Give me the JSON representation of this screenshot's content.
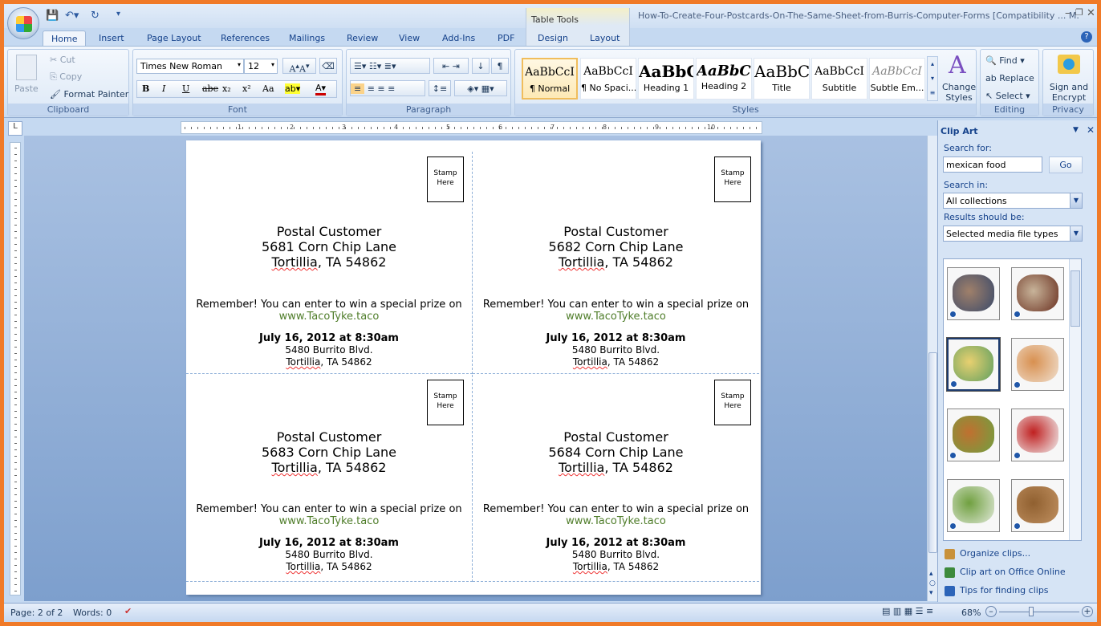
{
  "app": {
    "title": "How-To-Create-Four-Postcards-On-The-Same-Sheet-from-Burris-Computer-Forms [Compatibility ... M.",
    "contextual_group": "Table Tools"
  },
  "quick_access": [
    "save-icon",
    "undo-icon",
    "redo-icon",
    "customize-icon"
  ],
  "tabs": [
    "Home",
    "Insert",
    "Page Layout",
    "References",
    "Mailings",
    "Review",
    "View",
    "Add-Ins",
    "PDF",
    "Design",
    "Layout"
  ],
  "active_tab": "Home",
  "ribbon": {
    "clipboard": {
      "label": "Clipboard",
      "paste": "Paste",
      "cut": "Cut",
      "copy": "Copy",
      "format_painter": "Format Painter"
    },
    "font": {
      "label": "Font",
      "font_name": "Times New Roman",
      "font_size": "12",
      "buttons": [
        "B",
        "I",
        "U",
        "abe",
        "x₂",
        "x²",
        "Aa"
      ]
    },
    "paragraph": {
      "label": "Paragraph"
    },
    "styles": {
      "label": "Styles",
      "items": [
        {
          "sample": "AaBbCcI",
          "name": "¶ Normal"
        },
        {
          "sample": "AaBbCcI",
          "name": "¶ No Spaci..."
        },
        {
          "sample": "AaBbC",
          "name": "Heading 1"
        },
        {
          "sample": "AaBbCc",
          "name": "Heading 2"
        },
        {
          "sample": "AaBbC",
          "name": "Title"
        },
        {
          "sample": "AaBbCcI",
          "name": "Subtitle"
        },
        {
          "sample": "AaBbCcI",
          "name": "Subtle Em..."
        }
      ],
      "change_styles": "Change Styles"
    },
    "editing": {
      "label": "Editing",
      "find": "Find",
      "replace": "Replace",
      "select": "Select"
    },
    "privacy": {
      "label": "Privacy",
      "sign": "Sign and Encrypt"
    }
  },
  "ruler_numbers": [
    "1",
    "2",
    "3",
    "4",
    "5",
    "6",
    "7",
    "8",
    "9",
    "10"
  ],
  "postcards": [
    {
      "stamp": "Stamp Here",
      "name": "Postal Customer",
      "street": "5681 Corn Chip Lane",
      "city": "Tortillia",
      "statezip": ", TA 54862",
      "message": "Remember! You can enter to win a special prize on",
      "url": "www.TacoTyke.taco",
      "date": "July 16, 2012 at 8:30am",
      "venue": "5480 Burrito Blvd.",
      "venue_city": "Tortillia",
      "venue_statezip": ", TA 54862"
    },
    {
      "stamp": "Stamp Here",
      "name": "Postal Customer",
      "street": "5682 Corn Chip Lane",
      "city": "Tortillia",
      "statezip": ", TA 54862",
      "message": "Remember! You can enter to win a special prize on",
      "url": "www.TacoTyke.taco",
      "date": "July 16, 2012 at 8:30am",
      "venue": "5480 Burrito Blvd.",
      "venue_city": "Tortillia",
      "venue_statezip": ", TA 54862"
    },
    {
      "stamp": "Stamp Here",
      "name": "Postal Customer",
      "street": "5683 Corn Chip Lane",
      "city": "Tortillia",
      "statezip": ", TA 54862",
      "message": "Remember! You can enter to win a special prize on",
      "url": "www.TacoTyke.taco",
      "date": "July 16, 2012 at 8:30am",
      "venue": "5480 Burrito Blvd.",
      "venue_city": "Tortillia",
      "venue_statezip": ", TA 54862"
    },
    {
      "stamp": "Stamp Here",
      "name": "Postal Customer",
      "street": "5684 Corn Chip Lane",
      "city": "Tortillia",
      "statezip": ", TA 54862",
      "message": "Remember! You can enter to win a special prize on",
      "url": "www.TacoTyke.taco",
      "date": "July 16, 2012 at 8:30am",
      "venue": "5480 Burrito Blvd.",
      "venue_city": "Tortillia",
      "venue_statezip": ", TA 54862"
    }
  ],
  "clip_art": {
    "title": "Clip Art",
    "search_label": "Search for:",
    "search_value": "mexican food",
    "go": "Go",
    "search_in_label": "Search in:",
    "search_in_value": "All collections",
    "results_label": "Results should be:",
    "results_value": "Selected media file types",
    "thumbnails": [
      {
        "colors": [
          "#a0806a",
          "#3a4a6a"
        ]
      },
      {
        "colors": [
          "#c8b49a",
          "#6a3020"
        ]
      },
      {
        "colors": [
          "#e8d070",
          "#60a060"
        ],
        "selected": true
      },
      {
        "colors": [
          "#d89050",
          "#f0e0d0"
        ]
      },
      {
        "colors": [
          "#c07030",
          "#70a040"
        ]
      },
      {
        "colors": [
          "#c02020",
          "#f0f0f0"
        ]
      },
      {
        "colors": [
          "#70a040",
          "#e0e8d8"
        ]
      },
      {
        "colors": [
          "#906030",
          "#c09060"
        ]
      }
    ],
    "links": [
      {
        "label": "Organize clips...",
        "icon": "organize-icon"
      },
      {
        "label": "Clip art on Office Online",
        "icon": "office-online-icon"
      },
      {
        "label": "Tips for finding clips",
        "icon": "help-icon"
      }
    ]
  },
  "status": {
    "page": "Page: 2 of 2",
    "words": "Words: 0",
    "zoom": "68%",
    "zoom_level": 0.68
  },
  "colors": {
    "accent": "#15428b",
    "frame": "#f07a28",
    "link": "#4f7d2a"
  }
}
